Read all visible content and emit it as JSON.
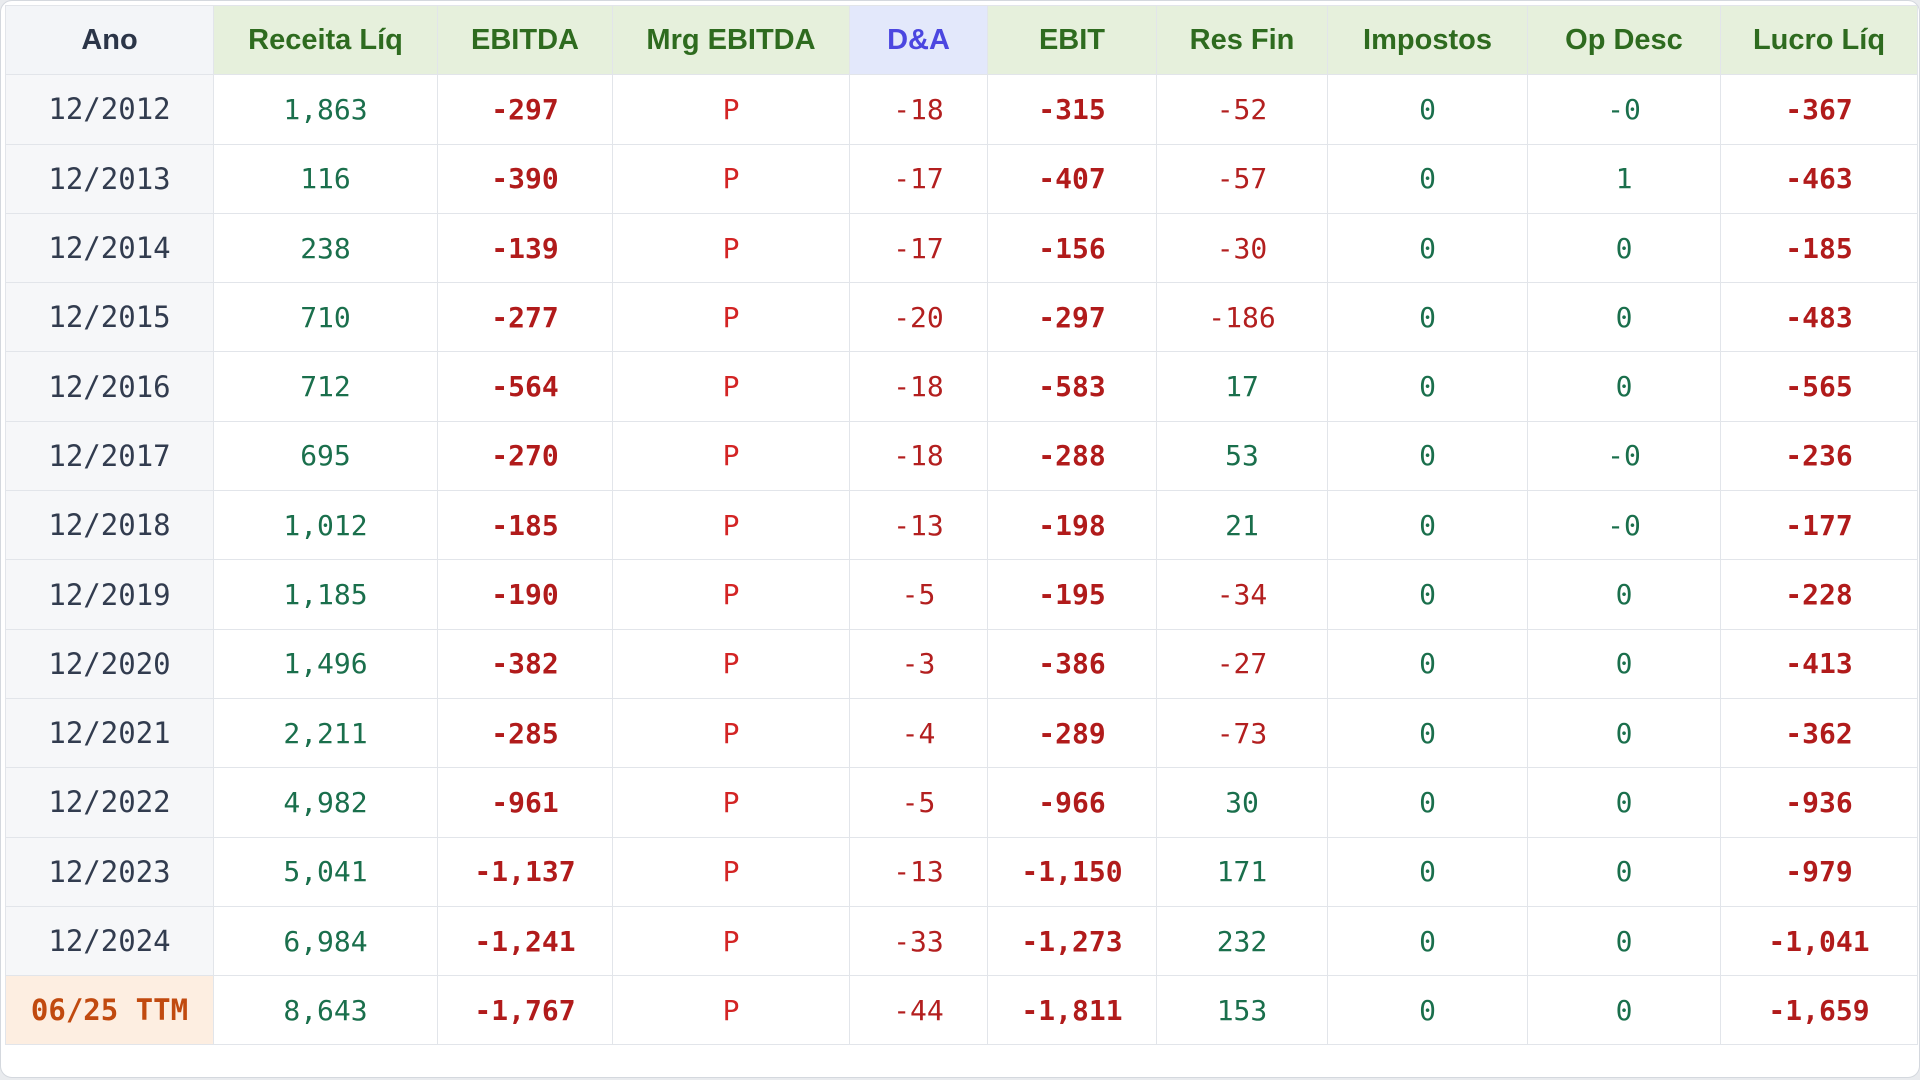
{
  "table": {
    "headers": [
      "Ano",
      "Receita Líq",
      "EBITDA",
      "Mrg EBITDA",
      "D&A",
      "EBIT",
      "Res Fin",
      "Impostos",
      "Op Desc",
      "Lucro Líq"
    ],
    "rows": [
      [
        "12/2012",
        "1,863",
        "-297",
        "P",
        "-18",
        "-315",
        "-52",
        "0",
        "-0",
        "-367"
      ],
      [
        "12/2013",
        "116",
        "-390",
        "P",
        "-17",
        "-407",
        "-57",
        "0",
        "1",
        "-463"
      ],
      [
        "12/2014",
        "238",
        "-139",
        "P",
        "-17",
        "-156",
        "-30",
        "0",
        "0",
        "-185"
      ],
      [
        "12/2015",
        "710",
        "-277",
        "P",
        "-20",
        "-297",
        "-186",
        "0",
        "0",
        "-483"
      ],
      [
        "12/2016",
        "712",
        "-564",
        "P",
        "-18",
        "-583",
        "17",
        "0",
        "0",
        "-565"
      ],
      [
        "12/2017",
        "695",
        "-270",
        "P",
        "-18",
        "-288",
        "53",
        "0",
        "-0",
        "-236"
      ],
      [
        "12/2018",
        "1,012",
        "-185",
        "P",
        "-13",
        "-198",
        "21",
        "0",
        "-0",
        "-177"
      ],
      [
        "12/2019",
        "1,185",
        "-190",
        "P",
        "-5",
        "-195",
        "-34",
        "0",
        "0",
        "-228"
      ],
      [
        "12/2020",
        "1,496",
        "-382",
        "P",
        "-3",
        "-386",
        "-27",
        "0",
        "0",
        "-413"
      ],
      [
        "12/2021",
        "2,211",
        "-285",
        "P",
        "-4",
        "-289",
        "-73",
        "0",
        "0",
        "-362"
      ],
      [
        "12/2022",
        "4,982",
        "-961",
        "P",
        "-5",
        "-966",
        "30",
        "0",
        "0",
        "-936"
      ],
      [
        "12/2023",
        "5,041",
        "-1,137",
        "P",
        "-13",
        "-1,150",
        "171",
        "0",
        "0",
        "-979"
      ],
      [
        "12/2024",
        "6,984",
        "-1,241",
        "P",
        "-33",
        "-1,273",
        "232",
        "0",
        "0",
        "-1,041"
      ],
      [
        "06/25 TTM",
        "8,643",
        "-1,767",
        "P",
        "-44",
        "-1,811",
        "153",
        "0",
        "0",
        "-1,659"
      ]
    ]
  },
  "colors": {
    "positive": "#1a6f4c",
    "negative": "#b31f1f",
    "header_green": "#2e6b1f",
    "header_da": "#4b46e0",
    "ttm": "#c14a0f"
  }
}
